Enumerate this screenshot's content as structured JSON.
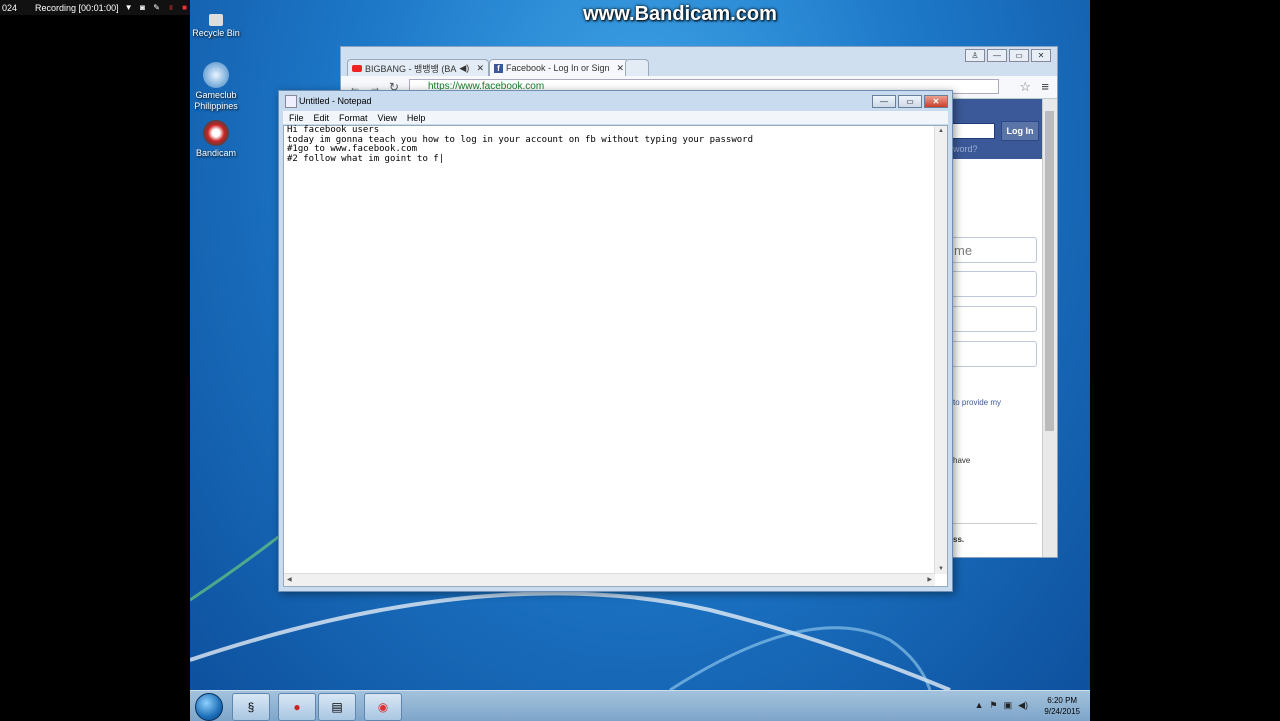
{
  "recording": {
    "left_text": "024",
    "label": "Recording [00:01:00]"
  },
  "watermark": "www.Bandicam.com",
  "desktop_icons": [
    {
      "name": "recycle-bin",
      "label": "Recycle Bin"
    },
    {
      "name": "gameclub",
      "label": "Gameclub Philippines"
    },
    {
      "name": "bandicam",
      "label": "Bandicam"
    }
  ],
  "chrome": {
    "tabs": [
      {
        "title": "BIGBANG - 뱅뱅뱅 (BA",
        "icon": "youtube-icon",
        "audio": "◀)"
      },
      {
        "title": "Facebook - Log In or Sign",
        "icon": "facebook-icon"
      }
    ],
    "url": "https://www.facebook.com",
    "login_button": "Log In",
    "forgot_text": "word?",
    "form_fields": [
      "me",
      "",
      "",
      ""
    ],
    "terms_text": "to provide my",
    "have_text": "have",
    "footer_text": "ss."
  },
  "notepad": {
    "title": "Untitled - Notepad",
    "menu": [
      "File",
      "Edit",
      "Format",
      "View",
      "Help"
    ],
    "lines": [
      "Hi facebook users",
      "today im gonna teach you how to log in your account on fb without typing your password",
      "#1go to www.facebook.com",
      "#2 follow what im goint to f|"
    ]
  },
  "taskbar": {
    "time": "6:20 PM",
    "date": "9/24/2015"
  },
  "colors": {
    "desktop": "#1d78c8",
    "facebook_blue": "#3b5998",
    "taskbar": "#8fb3d6"
  }
}
